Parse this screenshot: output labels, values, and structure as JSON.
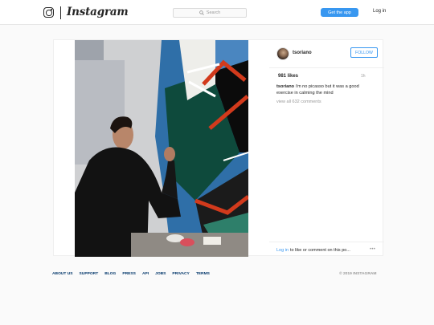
{
  "header": {
    "brand": "Instagram",
    "search_placeholder": "Search",
    "get_app_label": "Get the app",
    "login_label": "Log in"
  },
  "post": {
    "username": "tsoriano",
    "follow_label": "FOLLOW",
    "likes": "981 likes",
    "time_ago": "1h",
    "caption_user": "tsoriano",
    "caption_text": " i'm no picasso but it was a good exercise in calming the mind",
    "view_comments": "view all 632 comments",
    "login_link": "Log in",
    "login_rest": " to like or comment on this po...",
    "more_label": "•••"
  },
  "footer": {
    "links": [
      "ABOUT US",
      "SUPPORT",
      "BLOG",
      "PRESS",
      "API",
      "JOBS",
      "PRIVACY",
      "TERMS"
    ],
    "copyright": "© 2019 INSTAGRAM"
  },
  "colors": {
    "accent": "#3897f0",
    "footer_link": "#003569"
  },
  "icons": [
    "instagram-logo-icon",
    "search-icon",
    "more-options-icon"
  ]
}
